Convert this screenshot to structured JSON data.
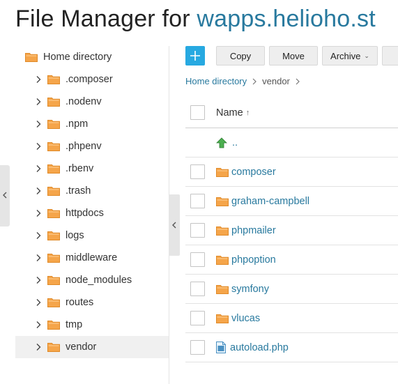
{
  "header": {
    "title_prefix": "File Manager for",
    "domain": "wapps.helioho.st"
  },
  "tree": {
    "root": "Home directory",
    "items": [
      {
        "label": ".composer"
      },
      {
        "label": ".nodenv"
      },
      {
        "label": ".npm"
      },
      {
        "label": ".phpenv"
      },
      {
        "label": ".rbenv"
      },
      {
        "label": ".trash"
      },
      {
        "label": "httpdocs"
      },
      {
        "label": "logs"
      },
      {
        "label": "middleware"
      },
      {
        "label": "node_modules"
      },
      {
        "label": "routes"
      },
      {
        "label": "tmp"
      },
      {
        "label": "vendor",
        "selected": true
      }
    ]
  },
  "toolbar": {
    "add_label": "+",
    "copy": "Copy",
    "move": "Move",
    "archive": "Archive"
  },
  "breadcrumb": {
    "home": "Home directory",
    "current": "vendor"
  },
  "table": {
    "name_header": "Name",
    "sort_indicator": "↑",
    "parent_label": "..",
    "rows": [
      {
        "name": "composer",
        "type": "folder"
      },
      {
        "name": "graham-campbell",
        "type": "folder"
      },
      {
        "name": "phpmailer",
        "type": "folder"
      },
      {
        "name": "phpoption",
        "type": "folder"
      },
      {
        "name": "symfony",
        "type": "folder"
      },
      {
        "name": "vlucas",
        "type": "folder"
      },
      {
        "name": "autoload.php",
        "type": "file"
      }
    ]
  },
  "colors": {
    "accent": "#27a9e1",
    "link": "#28799e",
    "folder": "#f5a54a",
    "up_arrow": "#4caf50"
  }
}
